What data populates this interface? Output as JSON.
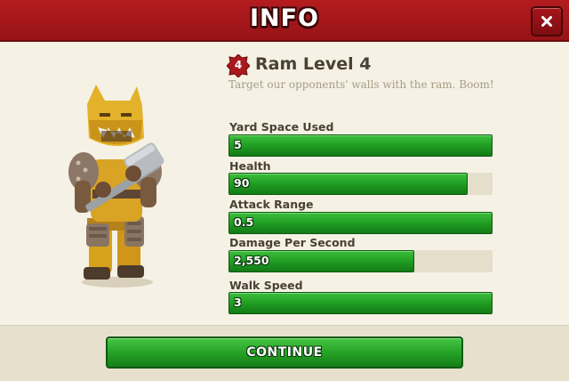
{
  "header": {
    "title": "INFO",
    "close_icon": "close-icon"
  },
  "unit": {
    "level": "4",
    "name": "Ram Level 4",
    "description": "Target our opponents' walls with the ram. Boom!",
    "portrait": "ram-warrior-character"
  },
  "stats": [
    {
      "label": "Yard Space Used",
      "value": "5",
      "fill": 1.0
    },
    {
      "label": "Health",
      "value": "90",
      "fill": 0.905
    },
    {
      "label": "Attack Range",
      "value": "0.5",
      "fill": 1.0
    },
    {
      "label": "Damage Per Second",
      "value": "2,550",
      "fill": 0.705
    },
    {
      "label": "Walk Speed",
      "value": "3",
      "fill": 1.0
    }
  ],
  "footer": {
    "continue_label": "CONTINUE"
  },
  "colors": {
    "header_red": "#b41c1f",
    "bar_green": "#1f9a22",
    "bar_track": "#e5decb",
    "background": "#f5f1e4"
  }
}
